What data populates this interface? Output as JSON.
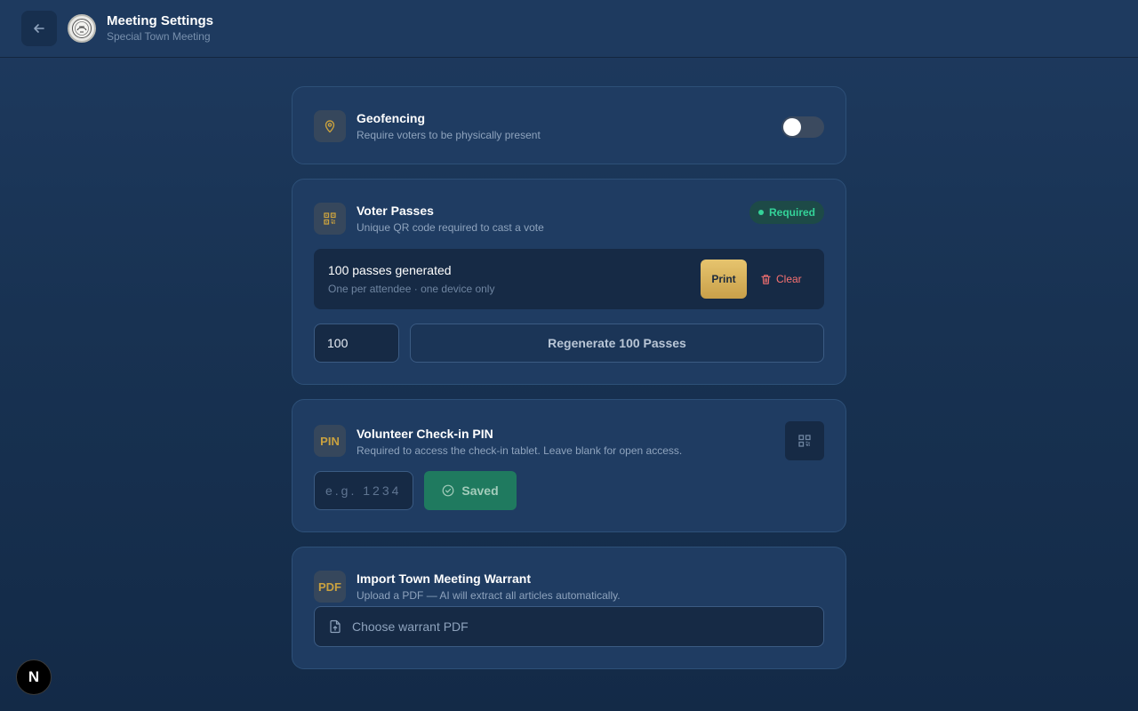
{
  "header": {
    "title": "Meeting Settings",
    "subtitle": "Special Town Meeting",
    "back_icon": "arrow-left-icon",
    "seal_icon": "town-seal-icon"
  },
  "geofencing": {
    "title": "Geofencing",
    "description": "Require voters to be physically present",
    "icon": "map-pin-icon",
    "enabled": false
  },
  "voter_passes": {
    "title": "Voter Passes",
    "description": "Unique QR code required to cast a vote",
    "icon": "qr-code-icon",
    "badge": "Required",
    "status_title": "100 passes generated",
    "status_subtitle": "One per attendee · one device only",
    "print_label": "Print",
    "clear_label": "Clear",
    "count_value": "100",
    "regenerate_label": "Regenerate 100 Passes"
  },
  "checkin_pin": {
    "icon_text": "PIN",
    "title": "Volunteer Check-in PIN",
    "description": "Required to access the check-in tablet. Leave blank for open access.",
    "pin_placeholder": "e.g. 1234",
    "pin_value": "",
    "saved_label": "Saved"
  },
  "warrant_import": {
    "icon_text": "PDF",
    "title": "Import Town Meeting Warrant",
    "description": "Upload a PDF — AI will extract all articles automatically.",
    "file_label": "Choose warrant PDF"
  },
  "dev_badge": {
    "label": "N"
  },
  "colors": {
    "background": "#1e3a5f",
    "card": "#1f3c62",
    "accent_gold": "#c9a13f",
    "success": "#34d399",
    "danger": "#f87171",
    "saved": "#1f7a5f"
  }
}
